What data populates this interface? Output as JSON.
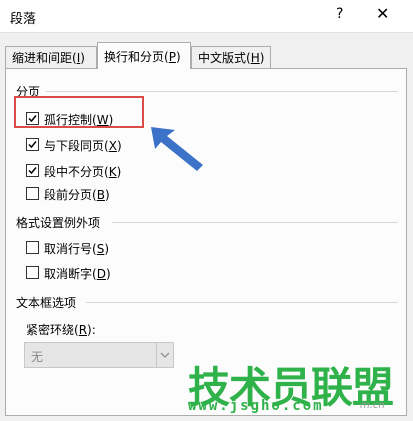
{
  "window": {
    "title": "段落",
    "help_label": "?",
    "close_label": "✕"
  },
  "tabs": [
    {
      "label": "缩进和间距",
      "hotkey": "I"
    },
    {
      "label": "换行和分页",
      "hotkey": "P"
    },
    {
      "label": "中文版式",
      "hotkey": "H"
    }
  ],
  "sections": {
    "pagination": {
      "title": "分页",
      "options": [
        {
          "label": "孤行控制",
          "hotkey": "W",
          "checked": true
        },
        {
          "label": "与下段同页",
          "hotkey": "X",
          "checked": true
        },
        {
          "label": "段中不分页",
          "hotkey": "K",
          "checked": true
        },
        {
          "label": "段前分页",
          "hotkey": "B",
          "checked": false
        }
      ]
    },
    "format_exceptions": {
      "title": "格式设置例外项",
      "options": [
        {
          "label": "取消行号",
          "hotkey": "S",
          "checked": false
        },
        {
          "label": "取消断字",
          "hotkey": "D",
          "checked": false
        }
      ]
    },
    "textbox": {
      "title": "文本框选项",
      "wrap_label": "紧密环绕",
      "wrap_hotkey": "R",
      "wrap_value": "无"
    }
  },
  "watermark": {
    "text": "技术员联盟",
    "url": "www.jsgho.com",
    "tag": "m.cn"
  },
  "colors": {
    "highlight": "#d94c48",
    "arrow": "#3c73c8",
    "watermark": "#2fb24a"
  },
  "icons": {
    "arrow": "arrow-icon",
    "checkmark": "checkmark-icon",
    "dropdown": "chevron-down-icon"
  }
}
